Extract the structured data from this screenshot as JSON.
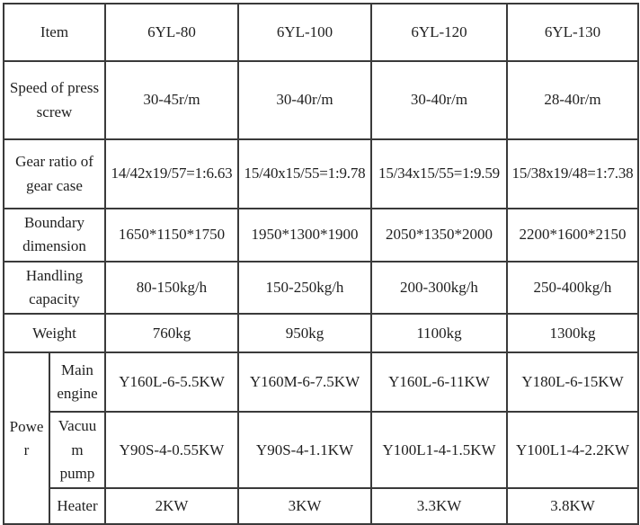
{
  "table": {
    "header": {
      "item_label": "Item",
      "models": [
        "6YL-80",
        "6YL-100",
        "6YL-120",
        "6YL-130"
      ]
    },
    "rows": [
      {
        "name": "speed-of-press-screw",
        "label": "Speed of press screw",
        "values": [
          "30-45r/m",
          "30-40r/m",
          "30-40r/m",
          "28-40r/m"
        ]
      },
      {
        "name": "gear-ratio-of-gear-case",
        "label": "Gear ratio of gear case",
        "values": [
          "14/42x19/57=1:6.63",
          "15/40x15/55=1:9.78",
          "15/34x15/55=1:9.59",
          "15/38x19/48=1:7.38"
        ]
      },
      {
        "name": "boundary-dimension",
        "label": "Boundary dimension",
        "values": [
          "1650*1150*1750",
          "1950*1300*1900",
          "2050*1350*2000",
          "2200*1600*2150"
        ]
      },
      {
        "name": "handling-capacity",
        "label": "Handling capacity",
        "values": [
          "80-150kg/h",
          "150-250kg/h",
          "200-300kg/h",
          "250-400kg/h"
        ]
      },
      {
        "name": "weight",
        "label": "Weight",
        "values": [
          "760kg",
          "950kg",
          "1100kg",
          "1300kg"
        ]
      }
    ],
    "power": {
      "label": "Power",
      "subrows": [
        {
          "name": "main-engine",
          "label": "Main engine",
          "values": [
            "Y160L-6-5.5KW",
            "Y160M-6-7.5KW",
            "Y160L-6-11KW",
            "Y180L-6-15KW"
          ]
        },
        {
          "name": "vacuum-pump",
          "label": "Vacuum pump",
          "values": [
            "Y90S-4-0.55KW",
            "Y90S-4-1.1KW",
            "Y100L1-4-1.5KW",
            "Y100L1-4-2.2KW"
          ]
        },
        {
          "name": "heater",
          "label": "Heater",
          "values": [
            "2KW",
            "3KW",
            "3.3KW",
            "3.8KW"
          ]
        }
      ]
    }
  },
  "colors": {
    "header_background": "#c3c3c3",
    "border": "#3a3a3a",
    "text": "#1f1f1f",
    "cell_background": "#ffffff"
  }
}
